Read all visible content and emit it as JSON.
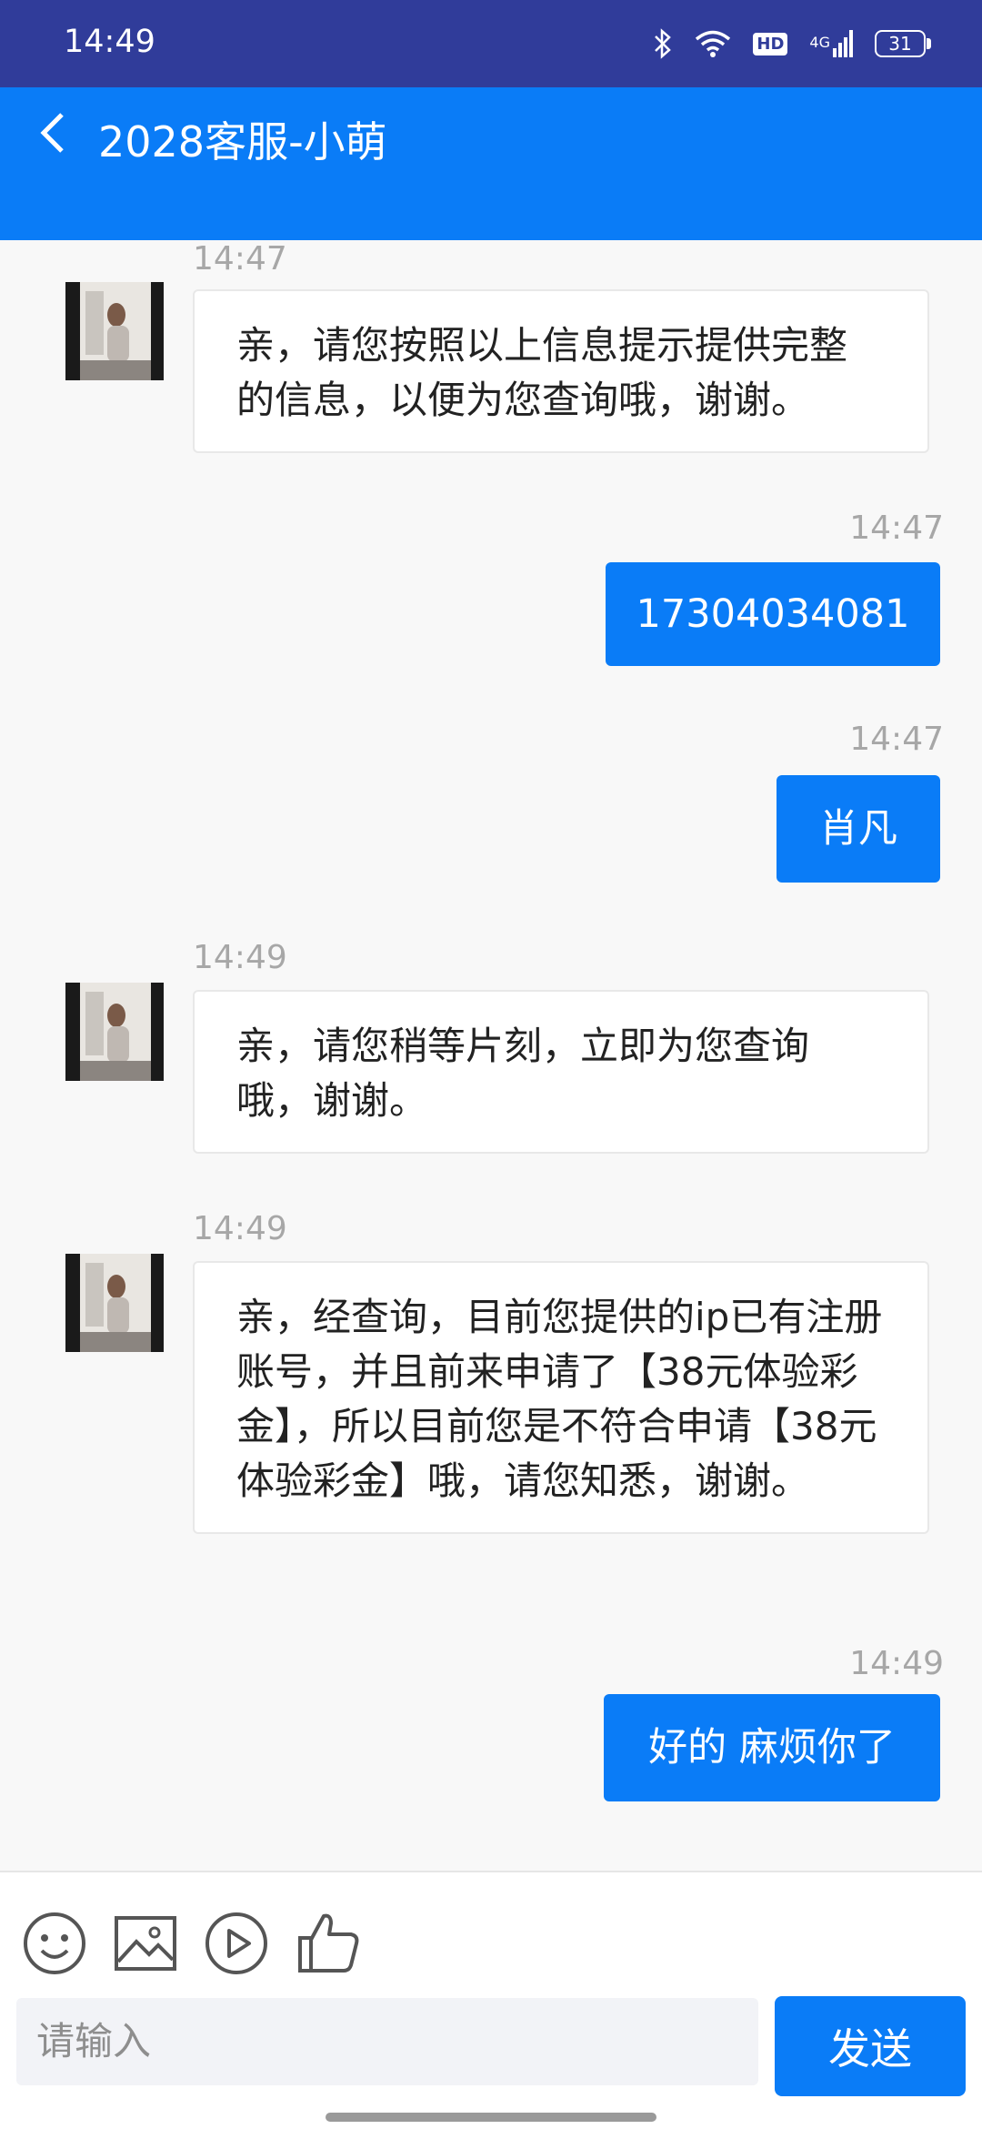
{
  "status_bar": {
    "time": "14:49",
    "network": "4G",
    "hd_label": "HD",
    "battery": "31"
  },
  "header": {
    "title": "2028客服-小萌",
    "back_icon": "chevron-left-icon"
  },
  "messages": [
    {
      "side": "in",
      "time": "14:47",
      "text": "亲，请您按照以上信息提示提供完整的信息，以便为您查询哦，谢谢。"
    },
    {
      "side": "out",
      "time": "14:47",
      "text": "17304034081"
    },
    {
      "side": "out",
      "time": "14:47",
      "text": "肖凡"
    },
    {
      "side": "in",
      "time": "14:49",
      "text": "亲，请您稍等片刻，立即为您查询哦，谢谢。"
    },
    {
      "side": "in",
      "time": "14:49",
      "text": "亲，经查询，目前您提供的ip已有注册账号，并且前来申请了【38元体验彩金】，所以目前您是不符合申请【38元体验彩金】哦，请您知悉，谢谢。"
    },
    {
      "side": "out",
      "time": "14:49",
      "text": "好的 麻烦你了"
    }
  ],
  "composer": {
    "placeholder": "请输入",
    "send_label": "发送",
    "tools": [
      "emoji-icon",
      "image-icon",
      "play-video-icon",
      "thumbs-up-icon"
    ]
  },
  "colors": {
    "accent": "#0a7cf7",
    "status_bar": "#303c9a"
  }
}
